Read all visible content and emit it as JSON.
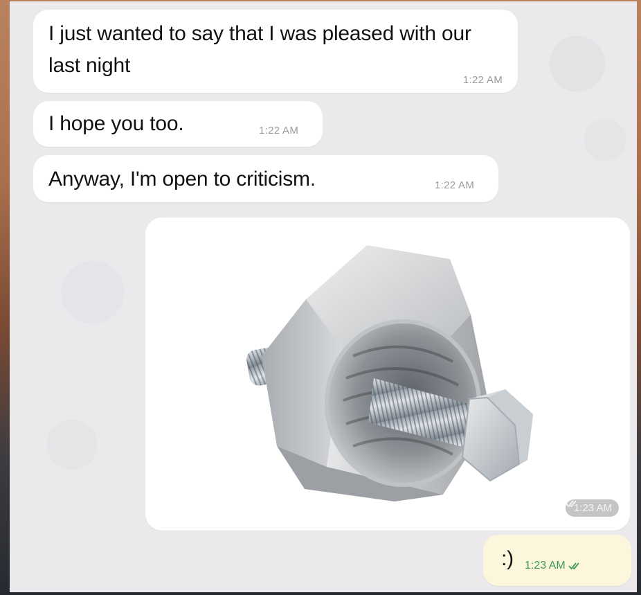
{
  "messages": [
    {
      "id": "m1",
      "direction": "incoming",
      "text": "I just wanted to say that I was pleased with our last night",
      "time": "1:22 AM"
    },
    {
      "id": "m2",
      "direction": "incoming",
      "text": "I hope you too.",
      "time": "1:22 AM"
    },
    {
      "id": "m3",
      "direction": "incoming",
      "text": "Anyway, I'm open to criticism.",
      "time": "1:22 AM"
    },
    {
      "id": "m4",
      "direction": "outgoing",
      "type": "image",
      "image_subject": "nut-and-bolt-photo",
      "time": "1:23 AM",
      "status_icon": "double-check-icon"
    },
    {
      "id": "m5",
      "direction": "outgoing",
      "text": ":)",
      "time": "1:23 AM",
      "status_icon": "double-check-icon"
    }
  ],
  "colors": {
    "incoming_bubble": "#ffffff",
    "outgoing_bubble": "#fcf7dc",
    "chat_background": "#ebe9ec",
    "read_check": "#3e9a5a"
  }
}
